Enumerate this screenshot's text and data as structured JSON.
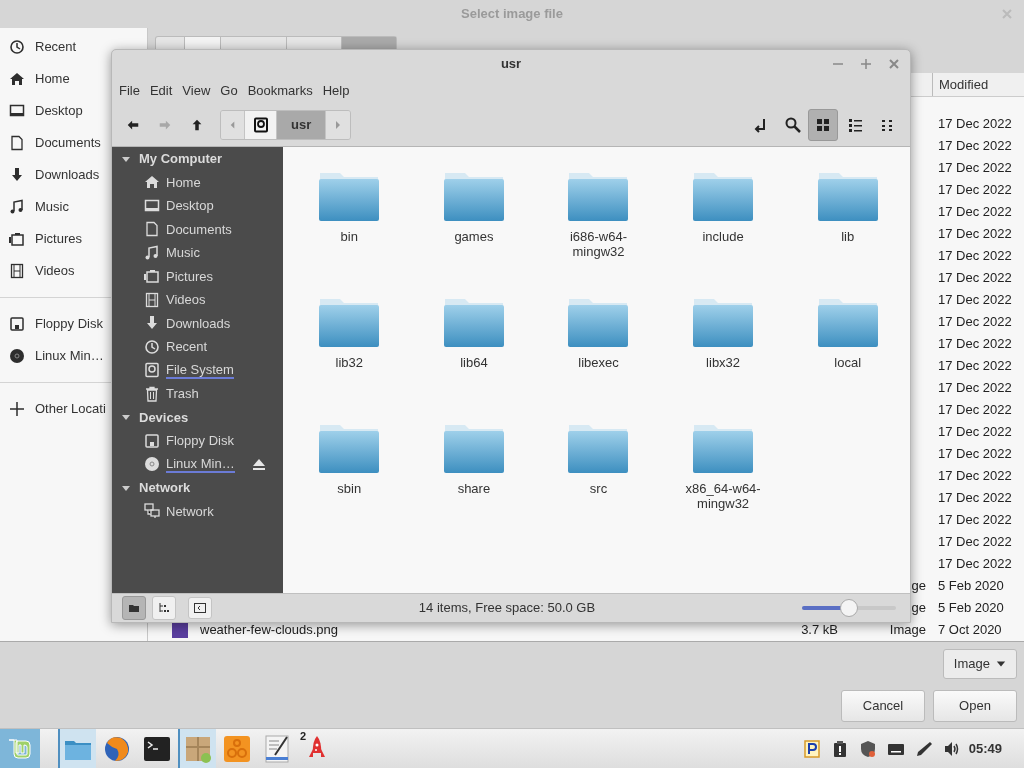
{
  "dialog": {
    "title": "Select image file",
    "places": [
      {
        "items": [
          {
            "kind": "recent",
            "label": "Recent"
          },
          {
            "kind": "home",
            "label": "Home"
          },
          {
            "kind": "desktop",
            "label": "Desktop"
          },
          {
            "kind": "documents",
            "label": "Documents"
          },
          {
            "kind": "downloads",
            "label": "Downloads"
          },
          {
            "kind": "music",
            "label": "Music"
          },
          {
            "kind": "pictures",
            "label": "Pictures"
          },
          {
            "kind": "videos",
            "label": "Videos"
          }
        ]
      },
      {
        "items": [
          {
            "kind": "floppy",
            "label": "Floppy Disk"
          },
          {
            "kind": "disc",
            "label": "Linux Min…"
          }
        ]
      },
      {
        "items": [
          {
            "kind": "plus",
            "label": "Other Locati"
          }
        ]
      }
    ],
    "list": {
      "column": "Modified",
      "rows": [
        {
          "date": "17 Dec 2022"
        },
        {
          "date": "17 Dec 2022"
        },
        {
          "date": "17 Dec 2022"
        },
        {
          "date": "17 Dec 2022"
        },
        {
          "date": "17 Dec 2022"
        },
        {
          "date": "17 Dec 2022"
        },
        {
          "date": "17 Dec 2022"
        },
        {
          "date": "17 Dec 2022"
        },
        {
          "date": "17 Dec 2022"
        },
        {
          "date": "17 Dec 2022"
        },
        {
          "date": "17 Dec 2022"
        },
        {
          "date": "17 Dec 2022"
        },
        {
          "date": "17 Dec 2022"
        },
        {
          "date": "17 Dec 2022"
        },
        {
          "date": "17 Dec 2022"
        },
        {
          "date": "17 Dec 2022"
        },
        {
          "date": "17 Dec 2022"
        },
        {
          "date": "17 Dec 2022"
        },
        {
          "date": "17 Dec 2022"
        },
        {
          "date": "17 Dec 2022"
        },
        {
          "date": "17 Dec 2022"
        },
        {
          "type": "ge",
          "date": "5 Feb 2020"
        },
        {
          "type": "ge",
          "date": "5 Feb 2020"
        },
        {
          "name": "weather-few-clouds.png",
          "size": "3.7 kB",
          "type": "Image",
          "date": "7 Oct 2020"
        }
      ]
    },
    "filter": "Image",
    "buttons": [
      "Cancel",
      "Open"
    ]
  },
  "window": {
    "title": "usr",
    "menu": [
      "File",
      "Edit",
      "View",
      "Go",
      "Bookmarks",
      "Help"
    ],
    "nav": [
      {
        "kind": "back",
        "disabled": false
      },
      {
        "kind": "forward",
        "disabled": true
      },
      {
        "kind": "up",
        "disabled": false
      }
    ],
    "path": [
      {
        "kind": "root",
        "selected": false
      },
      {
        "kind": "folder",
        "label": "usr",
        "selected": true
      }
    ],
    "views": [
      {
        "kind": "icons",
        "selected": true
      },
      {
        "kind": "list",
        "selected": false
      },
      {
        "kind": "compact",
        "selected": false
      }
    ],
    "sidebar": [
      {
        "label": "My Computer",
        "expanded": true,
        "items": [
          {
            "kind": "home",
            "label": "Home",
            "highlighted": false
          },
          {
            "kind": "desktop",
            "label": "Desktop",
            "highlighted": false
          },
          {
            "kind": "documents",
            "label": "Documents",
            "highlighted": false
          },
          {
            "kind": "music",
            "label": "Music",
            "highlighted": false
          },
          {
            "kind": "pictures",
            "label": "Pictures",
            "highlighted": false
          },
          {
            "kind": "videos",
            "label": "Videos",
            "highlighted": false
          },
          {
            "kind": "downloads",
            "label": "Downloads",
            "highlighted": false
          },
          {
            "kind": "recent",
            "label": "Recent",
            "highlighted": false
          },
          {
            "kind": "drive",
            "label": "File System",
            "highlighted": true
          },
          {
            "kind": "trash",
            "label": "Trash",
            "highlighted": false
          }
        ]
      },
      {
        "label": "Devices",
        "expanded": true,
        "items": [
          {
            "kind": "floppy",
            "label": "Floppy Disk",
            "highlighted": false
          },
          {
            "kind": "disc",
            "label": "Linux Min…",
            "highlighted": true,
            "eject": true
          }
        ]
      },
      {
        "label": "Network",
        "expanded": true,
        "items": [
          {
            "kind": "network",
            "label": "Network",
            "highlighted": false
          }
        ]
      }
    ],
    "folders": [
      "bin",
      "games",
      "i686-w64-mingw32",
      "include",
      "lib",
      "lib32",
      "lib64",
      "libexec",
      "libx32",
      "local",
      "sbin",
      "share",
      "src",
      "x86_64-w64-mingw32"
    ],
    "sidebar_modes": [
      {
        "kind": "places",
        "selected": true
      },
      {
        "kind": "tree",
        "selected": false
      }
    ],
    "status": "14 items, Free space: 50.0 GB",
    "zoom": {
      "level": 0.5
    }
  },
  "taskbar": {
    "launchers": [
      {
        "kind": "files",
        "active": true
      },
      {
        "kind": "browser",
        "active": false
      },
      {
        "kind": "terminal",
        "active": false
      },
      {
        "kind": "package",
        "active": true
      },
      {
        "kind": "orange",
        "active": false
      },
      {
        "kind": "editor",
        "active": false
      },
      {
        "kind": "rocket",
        "active": false,
        "badge": "2"
      }
    ],
    "tray": [
      {
        "kind": "p-app"
      },
      {
        "kind": "clipboard"
      },
      {
        "kind": "shield"
      },
      {
        "kind": "keyboard"
      },
      {
        "kind": "pen"
      },
      {
        "kind": "volume"
      }
    ],
    "clock": "05:49"
  }
}
